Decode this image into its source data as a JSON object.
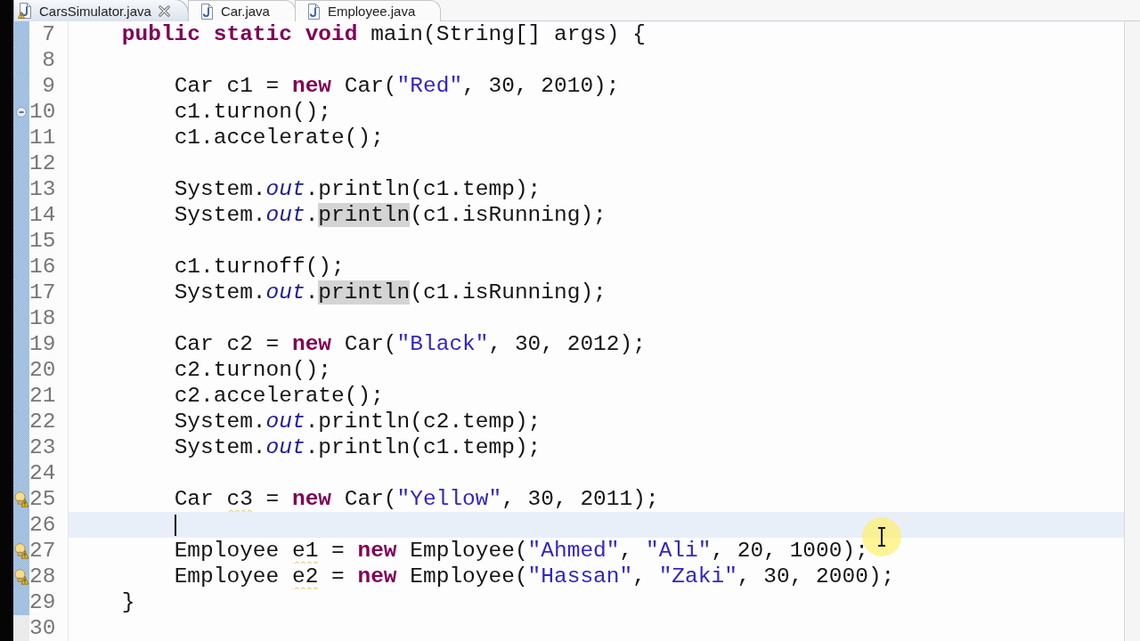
{
  "tabs": [
    {
      "label": "CarsSimulator.java",
      "selected": true,
      "warning": true
    },
    {
      "label": "Car.java",
      "selected": false,
      "warning": false
    },
    {
      "label": "Employee.java",
      "selected": false,
      "warning": false
    }
  ],
  "editor": {
    "lines": [
      {
        "number": "7",
        "range": true,
        "current": false,
        "tokens": [
          {
            "kind": "keyword",
            "text": "\tpublic static void"
          },
          {
            "kind": "plain",
            "text": " main(String[] args) {"
          }
        ]
      },
      {
        "number": "8",
        "range": true,
        "current": false
      },
      {
        "number": "9",
        "range": true,
        "current": false,
        "tokens": [
          {
            "kind": "plain",
            "text": "\t\tCar c1 = "
          },
          {
            "kind": "keyword",
            "text": "new"
          },
          {
            "kind": "plain",
            "text": " Car("
          },
          {
            "kind": "string",
            "text": "\"Red\""
          },
          {
            "kind": "plain",
            "text": ", 30, 2010);"
          }
        ]
      },
      {
        "number": "10",
        "range": true,
        "current": false,
        "marker": {
          "kind": "minus-circle"
        },
        "tokens": [
          {
            "kind": "plain",
            "text": "\t\tc1.turnon();"
          }
        ]
      },
      {
        "number": "11",
        "range": true,
        "current": false,
        "tokens": [
          {
            "kind": "plain",
            "text": "\t\tc1.accelerate();"
          }
        ]
      },
      {
        "number": "12",
        "range": true,
        "current": false
      },
      {
        "number": "13",
        "range": true,
        "current": false,
        "tokens": [
          {
            "kind": "plain",
            "text": "\t\tSystem."
          },
          {
            "kind": "static-field",
            "text": "out"
          },
          {
            "kind": "plain",
            "text": ".println(c1.temp);"
          }
        ]
      },
      {
        "number": "14",
        "range": true,
        "current": false,
        "tokens": [
          {
            "kind": "plain",
            "text": "\t\tSystem."
          },
          {
            "kind": "static-field",
            "text": "out"
          },
          {
            "kind": "plain",
            "text": "."
          },
          {
            "kind": "occurrence",
            "text": "println"
          },
          {
            "kind": "plain",
            "text": "(c1.isRunning);"
          }
        ]
      },
      {
        "number": "15",
        "range": true,
        "current": false
      },
      {
        "number": "16",
        "range": true,
        "current": false,
        "tokens": [
          {
            "kind": "plain",
            "text": "\t\tc1.turnoff();"
          }
        ]
      },
      {
        "number": "17",
        "range": true,
        "current": false,
        "tokens": [
          {
            "kind": "plain",
            "text": "\t\tSystem."
          },
          {
            "kind": "static-field",
            "text": "out"
          },
          {
            "kind": "plain",
            "text": "."
          },
          {
            "kind": "occurrence",
            "text": "println"
          },
          {
            "kind": "plain",
            "text": "(c1.isRunning);"
          }
        ]
      },
      {
        "number": "18",
        "range": true,
        "current": false
      },
      {
        "number": "19",
        "range": true,
        "current": false,
        "tokens": [
          {
            "kind": "plain",
            "text": "\t\tCar c2 = "
          },
          {
            "kind": "keyword",
            "text": "new"
          },
          {
            "kind": "plain",
            "text": " Car("
          },
          {
            "kind": "string",
            "text": "\"Black\""
          },
          {
            "kind": "plain",
            "text": ", 30, 2012);"
          }
        ]
      },
      {
        "number": "20",
        "range": true,
        "current": false,
        "tokens": [
          {
            "kind": "plain",
            "text": "\t\tc2.turnon();"
          }
        ]
      },
      {
        "number": "21",
        "range": true,
        "current": false,
        "tokens": [
          {
            "kind": "plain",
            "text": "\t\tc2.accelerate();"
          }
        ]
      },
      {
        "number": "22",
        "range": true,
        "current": false,
        "tokens": [
          {
            "kind": "plain",
            "text": "\t\tSystem."
          },
          {
            "kind": "static-field",
            "text": "out"
          },
          {
            "kind": "plain",
            "text": ".println(c2.temp);"
          }
        ]
      },
      {
        "number": "23",
        "range": true,
        "current": false,
        "tokens": [
          {
            "kind": "plain",
            "text": "\t\tSystem."
          },
          {
            "kind": "static-field",
            "text": "out"
          },
          {
            "kind": "plain",
            "text": ".println(c1.temp);"
          }
        ]
      },
      {
        "number": "24",
        "range": true,
        "current": false
      },
      {
        "number": "25",
        "range": true,
        "current": false,
        "marker": {
          "kind": "warning"
        },
        "tokens": [
          {
            "kind": "plain",
            "text": "\t\tCar "
          },
          {
            "kind": "unused-var",
            "text": "c3"
          },
          {
            "kind": "plain",
            "text": " = "
          },
          {
            "kind": "keyword",
            "text": "new"
          },
          {
            "kind": "plain",
            "text": " Car("
          },
          {
            "kind": "string",
            "text": "\"Yellow\""
          },
          {
            "kind": "plain",
            "text": ", 30, 2011);"
          }
        ]
      },
      {
        "number": "26",
        "range": true,
        "current": true
      },
      {
        "number": "27",
        "range": true,
        "current": false,
        "marker": {
          "kind": "warning"
        },
        "tokens": [
          {
            "kind": "plain",
            "text": "\t\tEmployee "
          },
          {
            "kind": "unused-var",
            "text": "e1"
          },
          {
            "kind": "plain",
            "text": " = "
          },
          {
            "kind": "keyword",
            "text": "new"
          },
          {
            "kind": "plain",
            "text": " Employee("
          },
          {
            "kind": "string",
            "text": "\"Ahmed\""
          },
          {
            "kind": "plain",
            "text": ", "
          },
          {
            "kind": "string",
            "text": "\"Ali\""
          },
          {
            "kind": "plain",
            "text": ", 20, 1000);"
          }
        ]
      },
      {
        "number": "28",
        "range": true,
        "current": false,
        "marker": {
          "kind": "warning"
        },
        "tokens": [
          {
            "kind": "plain",
            "text": "\t\tEmployee "
          },
          {
            "kind": "unused-var",
            "text": "e2"
          },
          {
            "kind": "plain",
            "text": " = "
          },
          {
            "kind": "keyword",
            "text": "new"
          },
          {
            "kind": "plain",
            "text": " Employee("
          },
          {
            "kind": "string",
            "text": "\"Hassan\""
          },
          {
            "kind": "plain",
            "text": ", "
          },
          {
            "kind": "string",
            "text": "\"Zaki\""
          },
          {
            "kind": "plain",
            "text": ", 30, 2000);"
          }
        ]
      },
      {
        "number": "29",
        "range": true,
        "current": false,
        "tokens": [
          {
            "kind": "plain",
            "text": "\t}"
          }
        ]
      },
      {
        "number": "30",
        "range": false,
        "current": false
      }
    ]
  }
}
